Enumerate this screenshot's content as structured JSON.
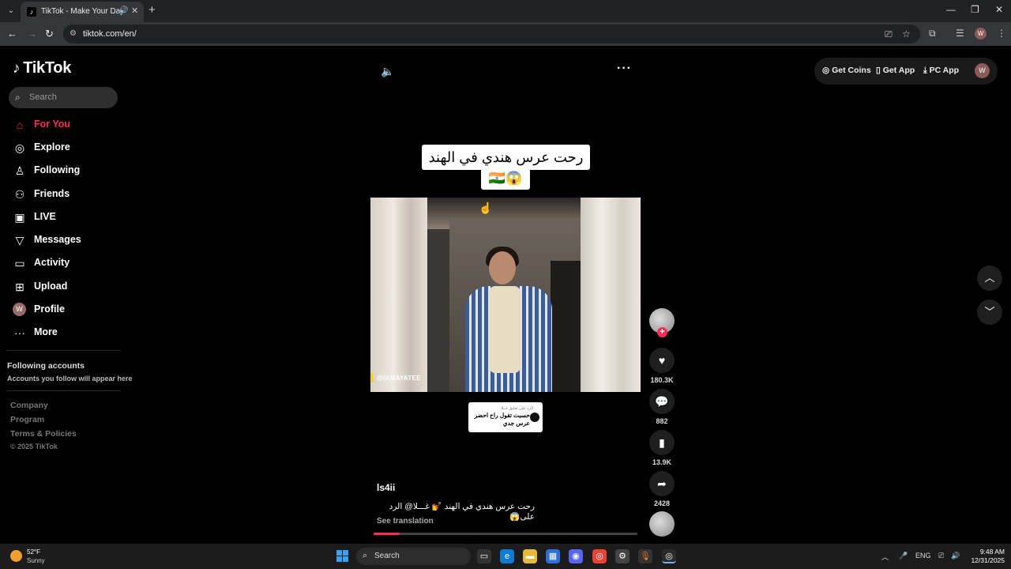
{
  "browser": {
    "tab_title": "TikTok - Make Your Day",
    "url": "tiktok.com/en/",
    "profile_initial": "W"
  },
  "sidebar": {
    "logo": "TikTok",
    "search_placeholder": "Search",
    "items": [
      {
        "label": "For You",
        "icon": "home-icon"
      },
      {
        "label": "Explore",
        "icon": "compass-icon"
      },
      {
        "label": "Following",
        "icon": "following-icon"
      },
      {
        "label": "Friends",
        "icon": "friends-icon"
      },
      {
        "label": "LIVE",
        "icon": "live-icon"
      },
      {
        "label": "Messages",
        "icon": "messages-icon"
      },
      {
        "label": "Activity",
        "icon": "activity-icon"
      },
      {
        "label": "Upload",
        "icon": "upload-icon"
      },
      {
        "label": "Profile",
        "icon": "avatar"
      },
      {
        "label": "More",
        "icon": "more-icon"
      }
    ],
    "profile_initial": "W",
    "following_accounts_title": "Following accounts",
    "following_accounts_sub": "Accounts you follow will appear here",
    "footer_links": [
      "Company",
      "Program",
      "Terms & Policies"
    ],
    "copyright": "© 2025 TikTok"
  },
  "topright": {
    "get_coins": "Get Coins",
    "get_app": "Get App",
    "pc_app": "PC App",
    "avatar_initial": "W"
  },
  "video": {
    "caption_line1": "رحت عرس هندي في الهند",
    "caption_line2": "🇮🇳😱",
    "watermark": "@IAMAYATEE",
    "reply_small": "الرد على تعليق غــلا",
    "reply_text": "حسبت تقول راح احضر عرس جدي",
    "author": "ls4ii",
    "description": "رحت عرس هندي في الهند 💅 غـــلا@ الرد على😱",
    "see_translation": "See translation",
    "progress": 0.1
  },
  "actions": {
    "likes": "180.3K",
    "comments": "882",
    "saves": "13.9K",
    "shares": "2428"
  },
  "taskbar": {
    "temp": "52°F",
    "condition": "Sunny",
    "search_label": "Search",
    "lang": "ENG",
    "time": "9:48 AM",
    "date": "12/31/2025"
  }
}
